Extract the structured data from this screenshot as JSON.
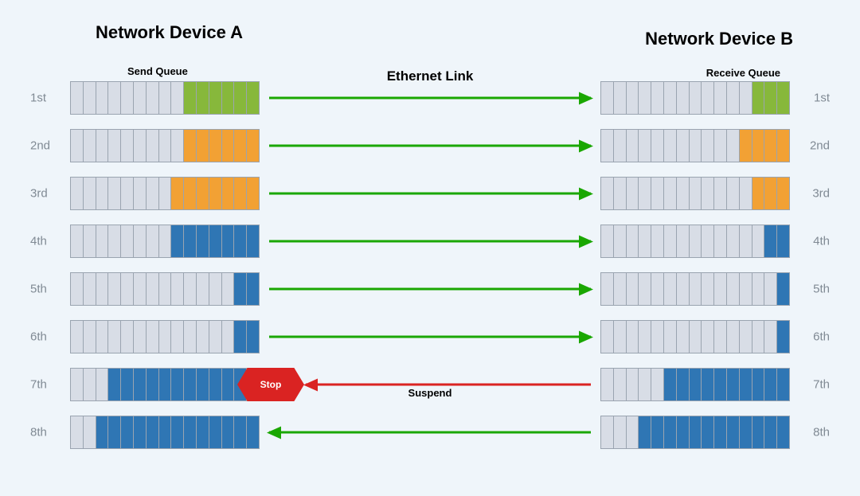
{
  "titles": {
    "a": "Network Device A",
    "b": "Network Device B"
  },
  "queue_labels": {
    "send": "Send Queue",
    "receive": "Receive Queue"
  },
  "link_label": "Ethernet Link",
  "suspend_label": "Suspend",
  "stop_label": "Stop",
  "cells_per_queue": 15,
  "colors": {
    "green": "#87b83b",
    "orange": "#f2a134",
    "blue": "#2f76b4",
    "arrow_green": "#1aa701",
    "arrow_red": "#da2322",
    "empty": "#d8dde6"
  },
  "rows": [
    {
      "n": "1st",
      "left_fill": 6,
      "left_color": "green",
      "right_fill": 3,
      "right_color": "green",
      "arrow": {
        "dir": "right",
        "color": "green"
      }
    },
    {
      "n": "2nd",
      "left_fill": 6,
      "left_color": "orange",
      "right_fill": 4,
      "right_color": "orange",
      "arrow": {
        "dir": "right",
        "color": "green"
      }
    },
    {
      "n": "3rd",
      "left_fill": 7,
      "left_color": "orange",
      "right_fill": 3,
      "right_color": "orange",
      "arrow": {
        "dir": "right",
        "color": "green"
      }
    },
    {
      "n": "4th",
      "left_fill": 7,
      "left_color": "blue",
      "right_fill": 2,
      "right_color": "blue",
      "arrow": {
        "dir": "right",
        "color": "green"
      }
    },
    {
      "n": "5th",
      "left_fill": 2,
      "left_color": "blue",
      "right_fill": 1,
      "right_color": "blue",
      "arrow": {
        "dir": "right",
        "color": "green"
      }
    },
    {
      "n": "6th",
      "left_fill": 2,
      "left_color": "blue",
      "right_fill": 1,
      "right_color": "blue",
      "arrow": {
        "dir": "right",
        "color": "green"
      }
    },
    {
      "n": "7th",
      "left_fill": 12,
      "left_color": "blue",
      "right_fill": 10,
      "right_color": "blue",
      "arrow": {
        "dir": "left",
        "color": "red"
      },
      "stop": true
    },
    {
      "n": "8th",
      "left_fill": 13,
      "left_color": "blue",
      "right_fill": 12,
      "right_color": "blue",
      "arrow": {
        "dir": "left",
        "color": "green"
      }
    }
  ]
}
